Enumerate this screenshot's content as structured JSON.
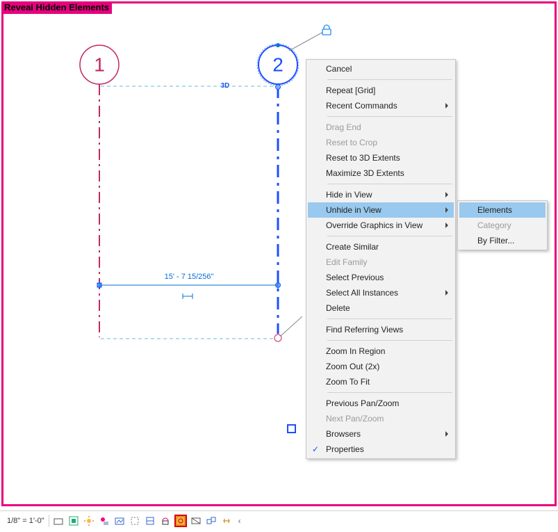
{
  "title": "Reveal Hidden Elements",
  "grids": {
    "g1": "1",
    "g2": "2"
  },
  "dim": {
    "text": "15' - 7 15/256\""
  },
  "d3_label": "3D",
  "context_menu": {
    "items": [
      {
        "label": "Cancel",
        "type": "item"
      },
      {
        "type": "sep"
      },
      {
        "label": "Repeat [Grid]",
        "type": "item"
      },
      {
        "label": "Recent Commands",
        "type": "sub"
      },
      {
        "type": "sep"
      },
      {
        "label": "Drag End",
        "type": "item",
        "disabled": true
      },
      {
        "label": "Reset to Crop",
        "type": "item",
        "disabled": true
      },
      {
        "label": "Reset to 3D Extents",
        "type": "item"
      },
      {
        "label": "Maximize 3D Extents",
        "type": "item"
      },
      {
        "type": "sep"
      },
      {
        "label": "Hide in View",
        "type": "sub"
      },
      {
        "label": "Unhide in View",
        "type": "sub",
        "highlight": true
      },
      {
        "label": "Override Graphics in View",
        "type": "sub"
      },
      {
        "type": "sep"
      },
      {
        "label": "Create Similar",
        "type": "item"
      },
      {
        "label": "Edit Family",
        "type": "item",
        "disabled": true
      },
      {
        "label": "Select Previous",
        "type": "item"
      },
      {
        "label": "Select All Instances",
        "type": "sub"
      },
      {
        "label": "Delete",
        "type": "item"
      },
      {
        "type": "sep"
      },
      {
        "label": "Find Referring Views",
        "type": "item"
      },
      {
        "type": "sep"
      },
      {
        "label": "Zoom In Region",
        "type": "item"
      },
      {
        "label": "Zoom Out (2x)",
        "type": "item"
      },
      {
        "label": "Zoom To Fit",
        "type": "item"
      },
      {
        "type": "sep"
      },
      {
        "label": "Previous Pan/Zoom",
        "type": "item"
      },
      {
        "label": "Next Pan/Zoom",
        "type": "item",
        "disabled": true
      },
      {
        "label": "Browsers",
        "type": "sub"
      },
      {
        "label": "Properties",
        "type": "item",
        "check": true
      }
    ],
    "submenu": [
      {
        "label": "Elements",
        "highlight": true
      },
      {
        "label": "Category",
        "disabled": true
      },
      {
        "label": "By Filter..."
      }
    ]
  },
  "statusbar": {
    "scale": "1/8\" = 1'-0\""
  },
  "colors": {
    "frame": "#e6007e",
    "grid1": "#c02865",
    "grid2": "#1a4fff",
    "dimension": "#006fd6",
    "highlight": "#99c9ee"
  }
}
